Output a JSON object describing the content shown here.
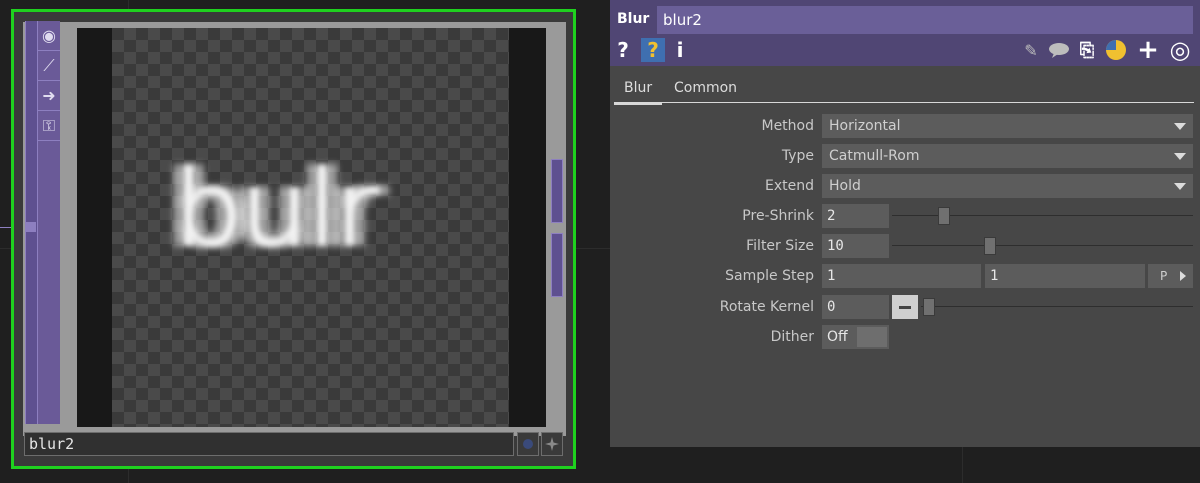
{
  "node": {
    "name": "blur2",
    "preview_text": "bulr",
    "side_buttons": [
      {
        "icon": "viewer-icon",
        "glyph": "◉"
      },
      {
        "icon": "graph-icon",
        "glyph": "⟋"
      },
      {
        "icon": "arrow-right-icon",
        "glyph": "➜"
      },
      {
        "icon": "lock-icon",
        "glyph": "⚿"
      }
    ],
    "selected_color": "#1fd11f"
  },
  "panel": {
    "op_type": "Blur",
    "op_name": "blur2",
    "header_icons_left": [
      {
        "name": "help-icon",
        "glyph": "?"
      },
      {
        "name": "op-help-icon",
        "glyph": "?"
      },
      {
        "name": "info-icon",
        "glyph": "i"
      }
    ],
    "header_icons_right": [
      {
        "name": "edit-icon",
        "glyph": "✎"
      },
      {
        "name": "comment-icon",
        "glyph": "💬"
      },
      {
        "name": "clipboard-icon",
        "glyph": "⎘"
      },
      {
        "name": "python-icon",
        "glyph": "◍"
      },
      {
        "name": "add-icon",
        "glyph": "+"
      },
      {
        "name": "target-icon",
        "glyph": "◎"
      }
    ],
    "tabs": [
      {
        "label": "Blur",
        "active": true
      },
      {
        "label": "Common",
        "active": false
      }
    ],
    "params": {
      "method": {
        "label": "Method",
        "value": "Horizontal"
      },
      "type": {
        "label": "Type",
        "value": "Catmull-Rom"
      },
      "extend": {
        "label": "Extend",
        "value": "Hold"
      },
      "pre_shrink": {
        "label": "Pre-Shrink",
        "value": "2",
        "slider": 0.16
      },
      "filter_size": {
        "label": "Filter Size",
        "value": "10",
        "slider": 0.32
      },
      "sample_step": {
        "label": "Sample Step",
        "value1": "1",
        "value2": "1",
        "p_label": "P"
      },
      "rotate_kernel": {
        "label": "Rotate Kernel",
        "value": "0",
        "slider": 0.0
      },
      "dither": {
        "label": "Dither",
        "value": "Off"
      }
    }
  }
}
